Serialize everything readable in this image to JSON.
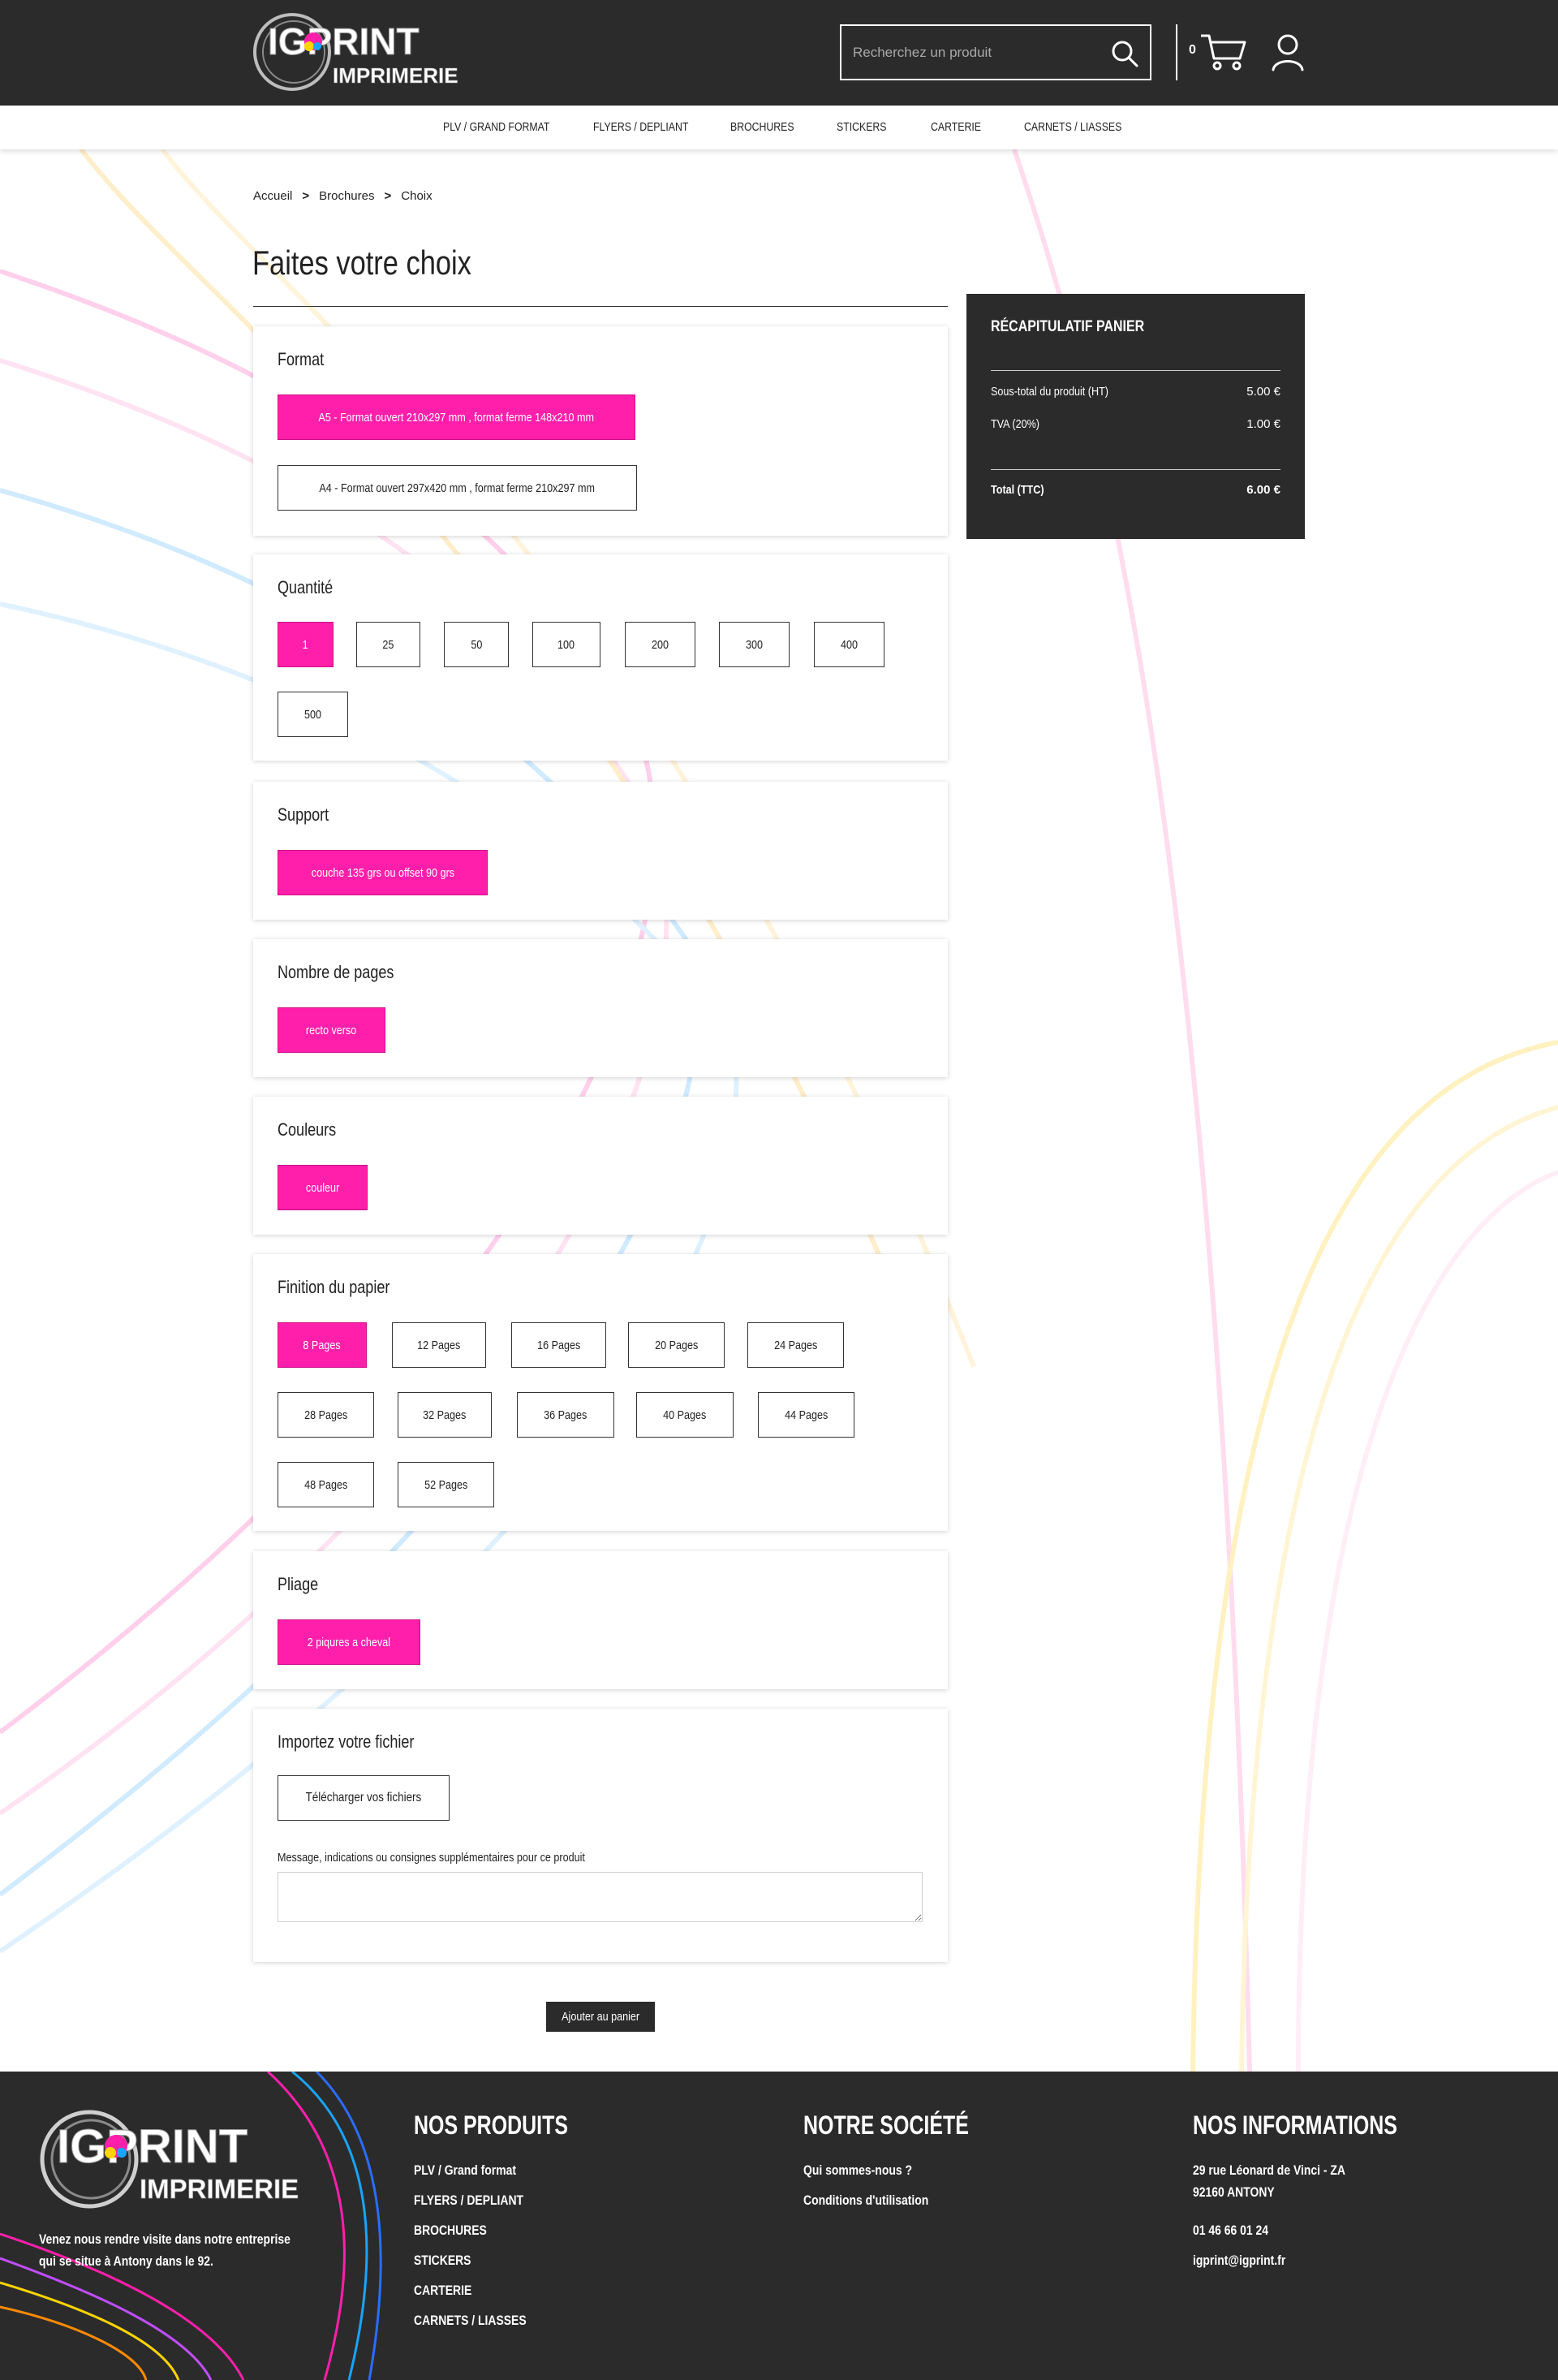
{
  "brand": {
    "logo_text_top": "IGPRINT",
    "logo_text_bottom": "IMPRIMERIE",
    "pink": "#ff1fab",
    "dark": "#2b2b2b"
  },
  "header": {
    "search_placeholder": "Recherchez un produit",
    "cart_count": "0",
    "icons": [
      "search-icon",
      "cart-icon",
      "user-icon"
    ]
  },
  "nav": {
    "items": [
      "PLV / GRAND FORMAT",
      "FLYERS / DEPLIANT",
      "BROCHURES",
      "STICKERS",
      "CARTERIE",
      "CARNETS / LIASSES"
    ]
  },
  "breadcrumb": {
    "items": [
      "Accueil",
      "Brochures",
      "Choix"
    ],
    "separator": ">"
  },
  "page_title": "Faites votre choix",
  "sections": {
    "format": {
      "title": "Format",
      "options": [
        "A5 - Format ouvert 210x297 mm , format ferme 148x210 mm",
        "A4 - Format ouvert 297x420 mm , format ferme 210x297 mm"
      ],
      "selected": 0
    },
    "quantite": {
      "title": "Quantité",
      "options": [
        "1",
        "25",
        "50",
        "100",
        "200",
        "300",
        "400",
        "500"
      ],
      "selected": 0
    },
    "support": {
      "title": "Support",
      "options": [
        "couche 135 grs ou offset 90 grs"
      ],
      "selected": 0
    },
    "pages": {
      "title": "Nombre de pages",
      "options": [
        "recto verso"
      ],
      "selected": 0
    },
    "couleurs": {
      "title": "Couleurs",
      "options": [
        "couleur"
      ],
      "selected": 0
    },
    "finition": {
      "title": "Finition du papier",
      "options": [
        "8 Pages",
        "12 Pages",
        "16 Pages",
        "20 Pages",
        "24 Pages",
        "28 Pages",
        "32 Pages",
        "36 Pages",
        "40 Pages",
        "44 Pages",
        "48 Pages",
        "52 Pages"
      ],
      "selected": 0
    },
    "pliage": {
      "title": "Pliage",
      "options": [
        "2 piqures a cheval"
      ],
      "selected": 0
    },
    "fichier": {
      "title": "Importez votre fichier",
      "upload_label": "Télécharger vos fichiers",
      "message_label": "Message, indications ou consignes supplémentaires pour ce produit",
      "message_value": ""
    }
  },
  "add_to_cart_label": "Ajouter au panier",
  "summary": {
    "title": "RÉCAPITULATIF PANIER",
    "subtotal_label": "Sous-total du produit (HT)",
    "subtotal_value": "5.00 €",
    "tva_label": "TVA (20%)",
    "tva_value": "1.00 €",
    "total_label": "Total (TTC)",
    "total_value": "6.00 €"
  },
  "footer": {
    "blurb": "Venez nous rendre visite dans notre entreprise qui se situe à Antony dans le 92.",
    "products_title": "NOS PRODUITS",
    "products": [
      "PLV / Grand format",
      "FLYERS / DEPLIANT",
      "BROCHURES",
      "STICKERS",
      "CARTERIE",
      "CARNETS / LIASSES"
    ],
    "company_title": "NOTRE SOCIÉTÉ",
    "company_links": [
      "Qui sommes-nous ?",
      "Conditions d'utilisation"
    ],
    "info_title": "NOS INFORMATIONS",
    "address_line1": "29 rue Léonard de Vinci - ZA",
    "address_line2": "92160 ANTONY",
    "phone": "01 46 66 01 24",
    "email": "igprint@igprint.fr"
  }
}
